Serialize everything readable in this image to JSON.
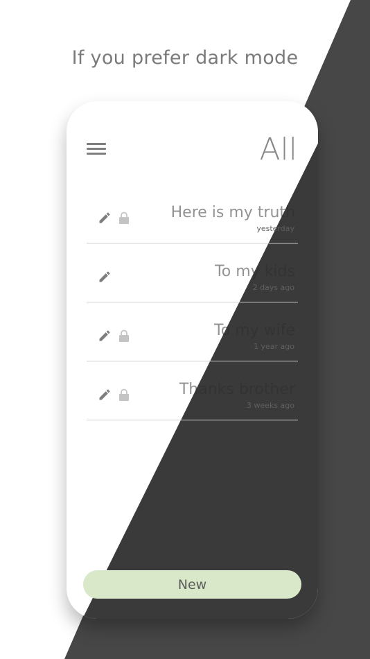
{
  "headline": "If you prefer dark mode",
  "header": {
    "title": "All"
  },
  "notes": [
    {
      "title": "Here is my truth",
      "date": "yesterday",
      "locked": true
    },
    {
      "title": "To my kids",
      "date": "2 days ago",
      "locked": false
    },
    {
      "title": "To my wife",
      "date": "1 year ago",
      "locked": true
    },
    {
      "title": "Thanks brother",
      "date": "3 weeks ago",
      "locked": true
    }
  ],
  "new_button": {
    "label": "New"
  },
  "colors": {
    "accent_button": "#d8e8c9",
    "dark_background": "#474747",
    "phone_dark": "#3a3a3a"
  },
  "icons": {
    "menu": "menu-icon",
    "edit": "pencil-icon",
    "lock": "lock-icon"
  }
}
